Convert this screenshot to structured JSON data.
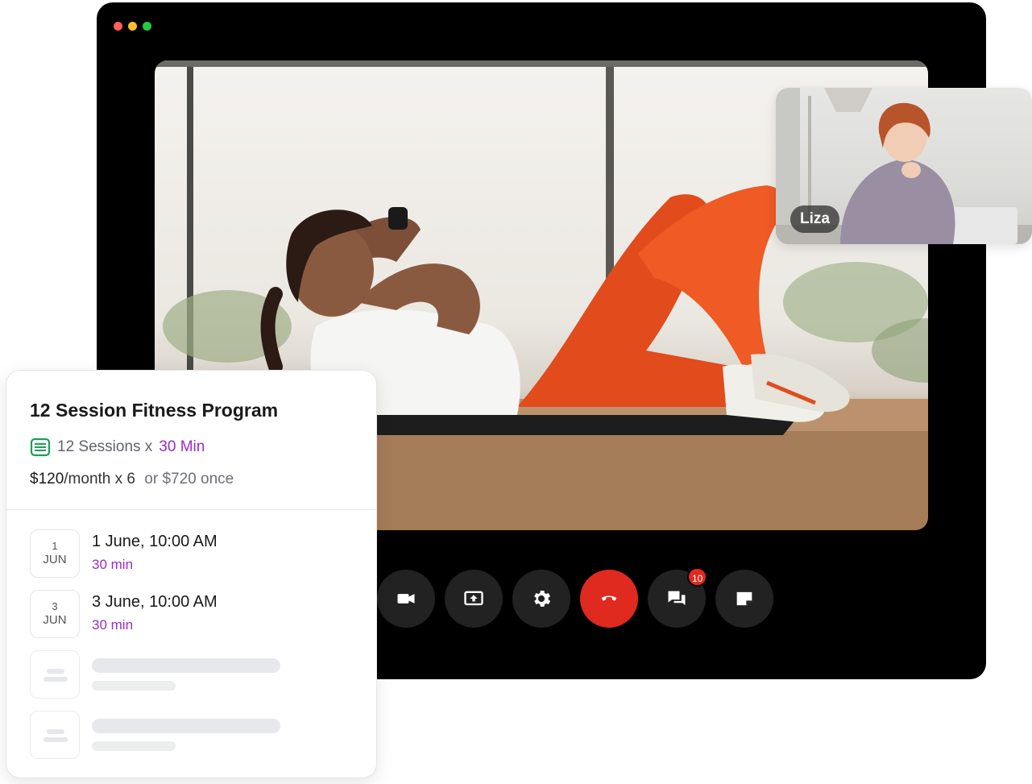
{
  "window": {
    "traffic_lights": [
      "#ff5f57",
      "#febc2e",
      "#28c840"
    ]
  },
  "main_video": {
    "description_icon": "video-feed"
  },
  "participant": {
    "name": "Liza"
  },
  "controls": {
    "buttons": [
      {
        "name": "camera",
        "icon": "video-camera-icon"
      },
      {
        "name": "share-screen",
        "icon": "screen-share-icon"
      },
      {
        "name": "settings",
        "icon": "gear-icon"
      },
      {
        "name": "end-call",
        "icon": "phone-hangup-icon"
      },
      {
        "name": "chat",
        "icon": "chat-icon",
        "badge": "10"
      },
      {
        "name": "notes",
        "icon": "note-icon"
      }
    ],
    "end_call_color": "#e0291f"
  },
  "program": {
    "title": "12 Session Fitness Program",
    "sessions_count": "12 Sessions x",
    "session_duration": "30 Min",
    "price_amount": "$120",
    "price_period": "/month x 6",
    "price_alt": "or $720 once",
    "accent_color": "#9b2cc9",
    "schedule": [
      {
        "day": "1",
        "month": "JUN",
        "when": "1 June, 10:00 AM",
        "length": "30 min"
      },
      {
        "day": "3",
        "month": "JUN",
        "when": "3 June, 10:00 AM",
        "length": "30 min"
      }
    ]
  }
}
